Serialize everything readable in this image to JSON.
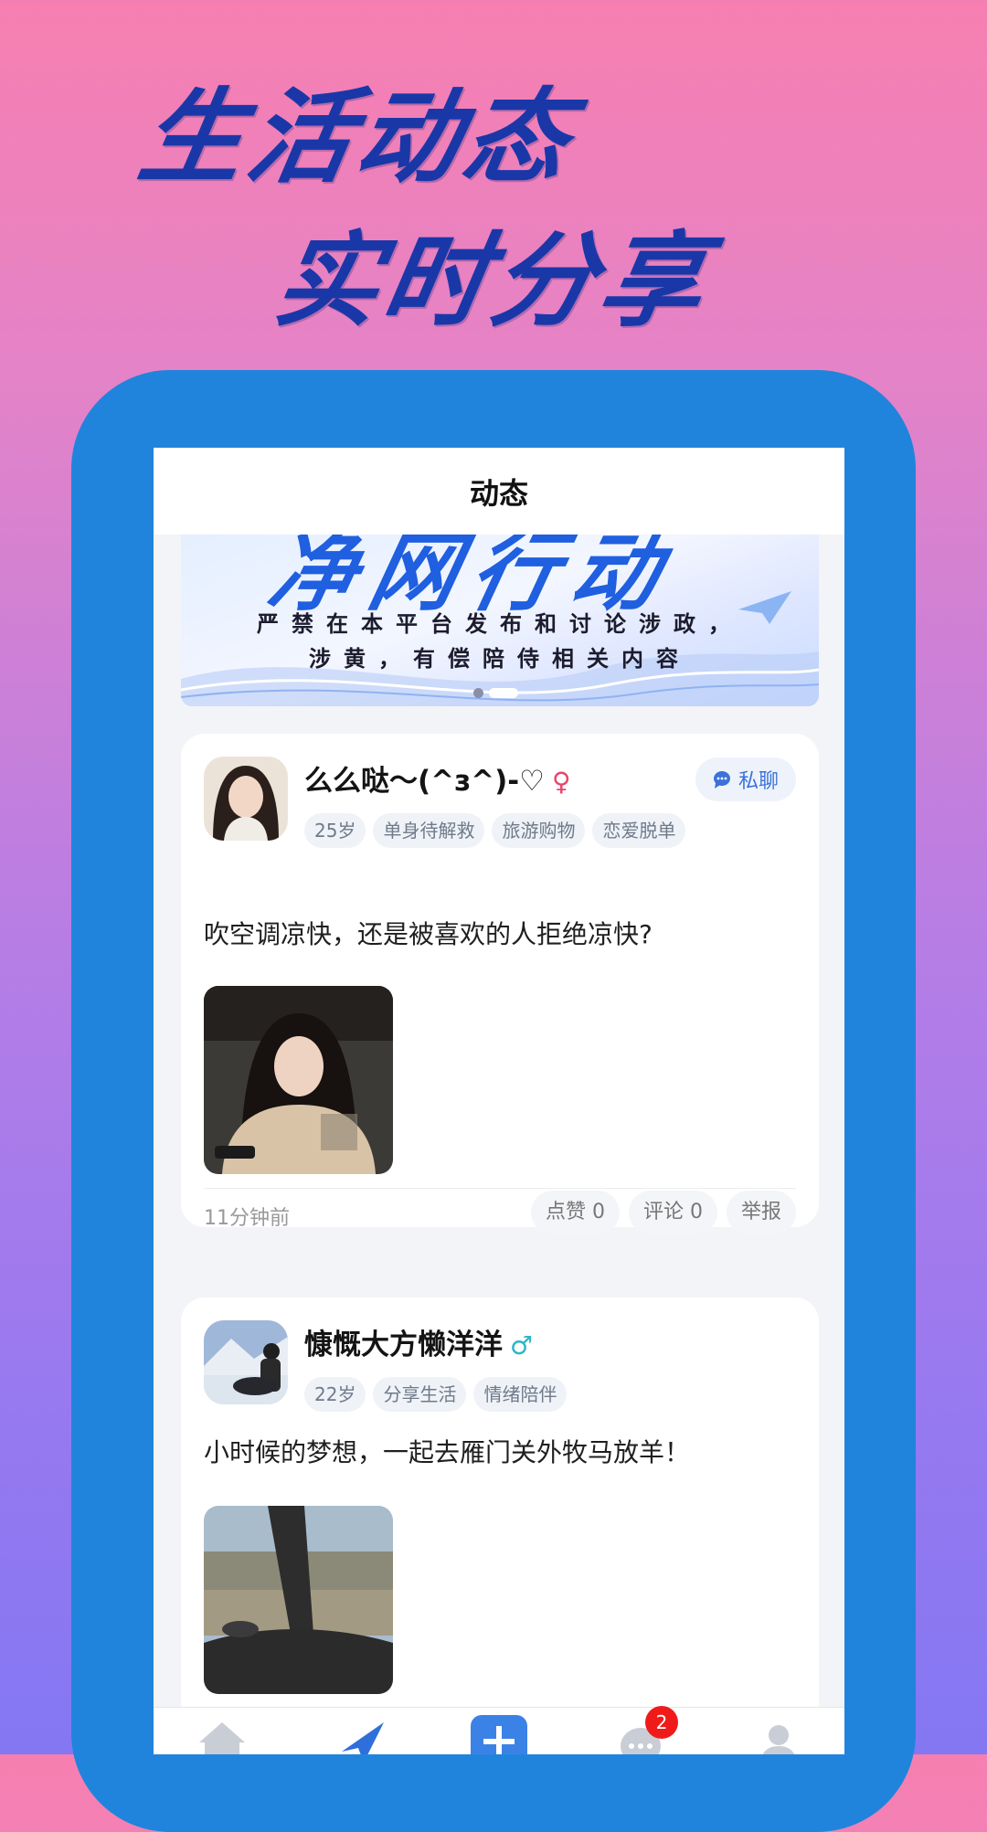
{
  "headline": {
    "line1": "生活动态",
    "line2": "实时分享"
  },
  "header": {
    "title": "动态"
  },
  "banner": {
    "title": "净网行动",
    "line1": "严禁在本平台发布和讨论涉政，",
    "line2": "涉黄，有偿陪侍相关内容"
  },
  "posts": [
    {
      "username": "么么哒～(^з^)-♡",
      "gender_symbol": "♀",
      "gender_color": "#e8456b",
      "tags": [
        "25岁",
        "单身待解救",
        "旅游购物",
        "恋爱脱单"
      ],
      "chat_label": "私聊",
      "text": "吹空调凉快，还是被喜欢的人拒绝凉快?",
      "time": "11分钟前",
      "like_label": "点赞 0",
      "comment_label": "评论 0",
      "report_label": "举报"
    },
    {
      "username": "慷慨大方懒洋洋",
      "gender_symbol": "♂",
      "gender_color": "#2bb6c9",
      "tags": [
        "22岁",
        "分享生活",
        "情绪陪伴"
      ],
      "text": "小时候的梦想，一起去雁门关外牧马放羊！"
    }
  ],
  "tabbar": {
    "message_badge": "2"
  },
  "colors": {
    "accent": "#2184dc",
    "headline": "#1a37a8",
    "badge": "#ef1b1b"
  }
}
